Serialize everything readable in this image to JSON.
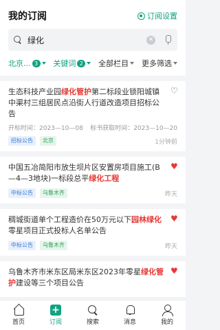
{
  "header": {
    "title": "我的订阅",
    "settings_label": "订阅设置"
  },
  "search": {
    "value": "绿化"
  },
  "filters": [
    {
      "label": "北京...",
      "badge": "3",
      "active": true
    },
    {
      "label": "关键词",
      "badge": "2",
      "active": true
    },
    {
      "label": "全部栏目",
      "active": false
    },
    {
      "label": "更多筛选",
      "active": false
    }
  ],
  "cards": [
    {
      "title_pre": "生态科技产业园",
      "title_hl": "绿化管护",
      "title_post": "第二标段业锁阳城镇中渠村三组居民点沿街人行道改造项目招标公告",
      "open_label": "开标时间：2023—10—08",
      "fetch_label": "标书获取时间：2023—10—20",
      "tags": [
        "招标公告",
        "北京"
      ],
      "time": "1分钟前",
      "favorite": false
    },
    {
      "title_pre": "中国五冶简阳市放生坝片区安置房项目施工(B—4—3地块)一标段总平",
      "title_hl": "绿化工程",
      "title_post": "",
      "tags": [
        "中标公告",
        "乌鲁木齐"
      ],
      "time": "昨天",
      "favorite": true
    },
    {
      "title_pre": "稠城街道单个工程造价在50万元以下",
      "title_hl": "园林绿化",
      "title_post": "零星项目正式投标人名单公告",
      "tags": [
        "中标公告",
        "乌鲁木齐"
      ],
      "time": "昨天",
      "favorite": true
    },
    {
      "title_pre": "乌鲁木齐市米东区局米东区2023年零星",
      "title_hl": "绿化管护",
      "title_post": "建设等三个项目公告",
      "tags": [],
      "time": "",
      "favorite": true
    }
  ],
  "tabbar": [
    {
      "label": "首页",
      "icon": "home-icon",
      "active": false
    },
    {
      "label": "订阅",
      "icon": "subscribe-icon",
      "active": true
    },
    {
      "label": "搜索",
      "icon": "search-icon",
      "active": false
    },
    {
      "label": "消息",
      "icon": "bell-icon",
      "active": false
    },
    {
      "label": "我的",
      "icon": "user-icon",
      "active": false
    }
  ],
  "colors": {
    "accent": "#11a37f",
    "highlight": "#e53935"
  }
}
